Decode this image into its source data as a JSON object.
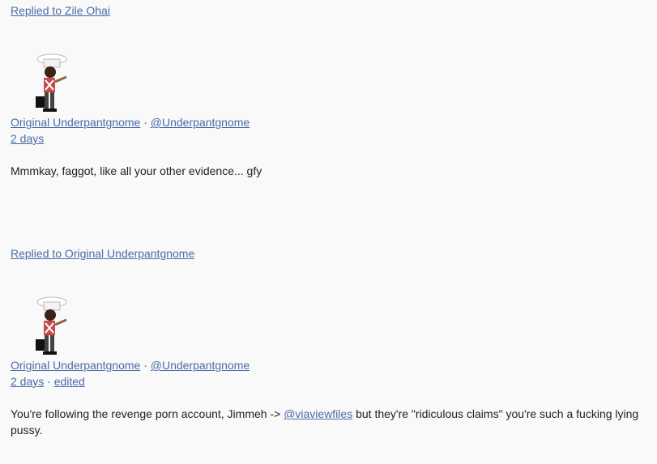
{
  "posts": [
    {
      "reply_to": "Replied to Zile Ohai",
      "author_name": "Original Underpantgnome",
      "author_handle": "@Underpantgnome",
      "separator": "·",
      "time": "2 days",
      "edited": "",
      "body_text": "Mmmkay, faggot, like all your other evidence... gfy"
    },
    {
      "reply_to": "Replied to Original Underpantgnome",
      "author_name": "Original Underpantgnome",
      "author_handle": "@Underpantgnome",
      "separator": "·",
      "time": "2 days",
      "edited": "edited",
      "body_before": "You're following the revenge porn account, Jimmeh -> ",
      "body_mention": "@viaviewfiles",
      "body_after": " but they're \"ridiculous claims\" you're such a fucking lying pussy."
    }
  ],
  "colors": {
    "link": "#4a6ba8",
    "text": "#222222",
    "background": "#f9f9f9"
  },
  "avatar_icon": "chef-gnome-avatar-icon"
}
